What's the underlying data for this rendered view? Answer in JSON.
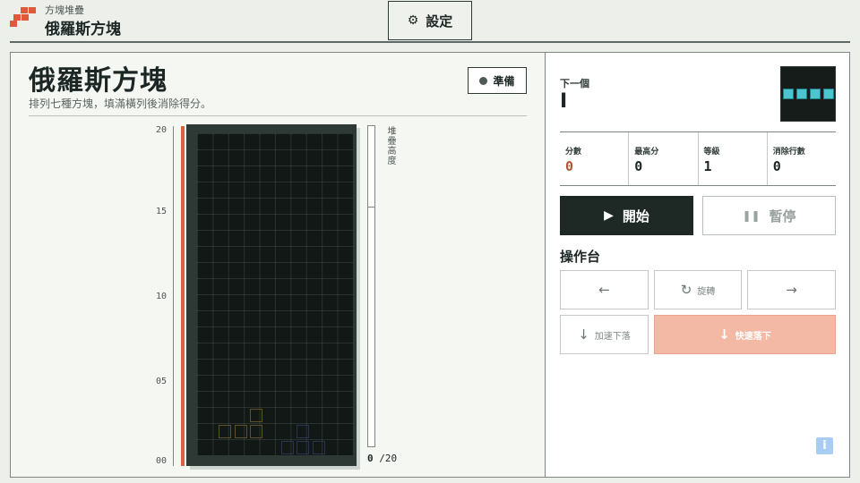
{
  "header": {
    "app_subtitle": "方塊堆疊",
    "app_title": "俄羅斯方塊",
    "settings_label": "設定",
    "settings_icon": "gear-icon"
  },
  "game": {
    "title": "俄羅斯方塊",
    "description": "排列七種方塊，填滿橫列後消除得分。",
    "status": "準備",
    "axis_labels": [
      "20",
      "15",
      "10",
      "05",
      "00"
    ],
    "gauge_label": "堆疊高度",
    "gauge_value": "0",
    "gauge_max": "/20",
    "colors": {
      "danger": "#d8613e",
      "board_bg": "#121816",
      "piece_outline_yellow": "#5e5229",
      "piece_outline_blue": "#2b3350"
    }
  },
  "side": {
    "next_label": "下一個",
    "next_piece": "I",
    "next_piece_color": "#4dc5cf",
    "stats": [
      {
        "label": "分數",
        "value": "0"
      },
      {
        "label": "最高分",
        "value": "0"
      },
      {
        "label": "等級",
        "value": "1"
      },
      {
        "label": "消除行數",
        "value": "0"
      }
    ],
    "start_label": "開始",
    "pause_label": "暫停",
    "controls_title": "操作台",
    "controls": {
      "left_icon": "←",
      "rotate_icon": "↻",
      "rotate_label": "旋轉",
      "right_icon": "→",
      "soft_drop_icon": "↓",
      "soft_drop_label": "加速下落",
      "hard_drop_icon": "↓",
      "hard_drop_label": "快速落下"
    },
    "info_label": "i",
    "accent_color": "#1e2926",
    "hard_drop_color": "#f4b9a4"
  }
}
